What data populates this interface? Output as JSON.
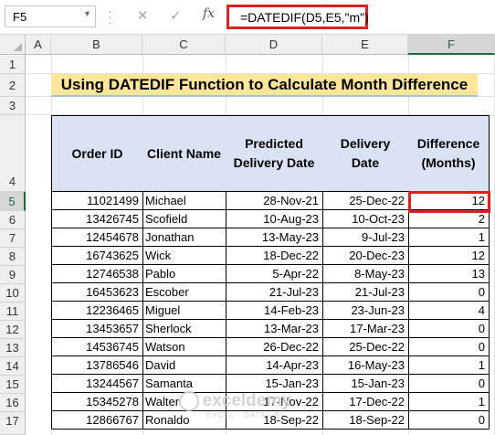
{
  "formula_bar": {
    "name_box": "F5",
    "cancel_icon": "✕",
    "enter_icon": "✓",
    "fx_label": "fx",
    "formula": "=DATEDIF(D5,E5,\"m\")"
  },
  "columns": [
    "A",
    "B",
    "C",
    "D",
    "E",
    "F"
  ],
  "rows": [
    "1",
    "2",
    "3",
    "4",
    "5",
    "6",
    "7",
    "8",
    "9",
    "10",
    "11",
    "12",
    "13",
    "14",
    "15",
    "16",
    "17"
  ],
  "title": "Using DATEDIF Function to Calculate Month Difference",
  "headers": {
    "order_id": "Order ID",
    "client_name": "Client Name",
    "predicted_1": "Predicted",
    "predicted_2": "Delivery Date",
    "delivery_1": "Delivery",
    "delivery_2": "Date",
    "difference_1": "Difference",
    "difference_2": "(Months)"
  },
  "table": [
    {
      "id": "11021499",
      "client": "Michael",
      "predicted": "28-Nov-21",
      "delivery": "25-Dec-22",
      "diff": "12"
    },
    {
      "id": "13426745",
      "client": "Scofield",
      "predicted": "10-Aug-23",
      "delivery": "10-Oct-23",
      "diff": "2"
    },
    {
      "id": "12454678",
      "client": "Jonathan",
      "predicted": "13-May-23",
      "delivery": "9-Jul-23",
      "diff": "1"
    },
    {
      "id": "16743625",
      "client": "Wick",
      "predicted": "18-Dec-22",
      "delivery": "20-Dec-23",
      "diff": "12"
    },
    {
      "id": "12746538",
      "client": "Pablo",
      "predicted": "5-Apr-22",
      "delivery": "8-May-23",
      "diff": "13"
    },
    {
      "id": "16453623",
      "client": "Escober",
      "predicted": "21-Jul-23",
      "delivery": "21-Jul-23",
      "diff": "0"
    },
    {
      "id": "12236465",
      "client": "Miguel",
      "predicted": "14-Feb-23",
      "delivery": "23-Jun-23",
      "diff": "4"
    },
    {
      "id": "13453657",
      "client": "Sherlock",
      "predicted": "13-Mar-23",
      "delivery": "17-Mar-23",
      "diff": "0"
    },
    {
      "id": "14536745",
      "client": "Watson",
      "predicted": "26-Dec-22",
      "delivery": "25-Dec-22",
      "diff": "0"
    },
    {
      "id": "13786546",
      "client": "David",
      "predicted": "14-Apr-23",
      "delivery": "16-May-23",
      "diff": "1"
    },
    {
      "id": "13244567",
      "client": "Samanta",
      "predicted": "15-Jan-23",
      "delivery": "15-Jan-23",
      "diff": "0"
    },
    {
      "id": "15345278",
      "client": "Walter",
      "predicted": "17-Nov-22",
      "delivery": "17-Dec-22",
      "diff": "1"
    },
    {
      "id": "12866767",
      "client": "Ronaldo",
      "predicted": "18-Sep-22",
      "delivery": "18-Sep-22",
      "diff": "0"
    }
  ],
  "watermark": {
    "brand": "exceldemy",
    "tag": "EXCEL · DATA · BI"
  },
  "colors": {
    "title_fill": "#ffe699",
    "header_fill": "#dae3f3",
    "highlight": "#e02020",
    "selected_green": "#1e6b3c"
  }
}
